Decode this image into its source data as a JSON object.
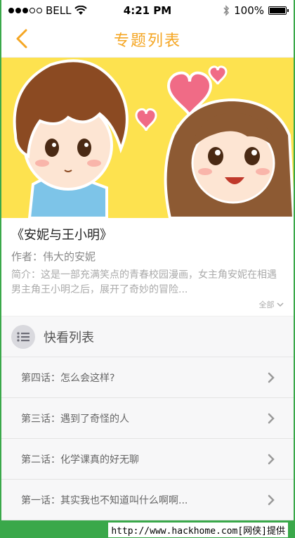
{
  "status_bar": {
    "carrier": "BELL",
    "time": "4:21 PM",
    "battery": "100%",
    "battery_level": 1.0,
    "icons": [
      "signal-dots-icon",
      "wifi-icon",
      "bluetooth-icon",
      "battery-icon"
    ]
  },
  "nav": {
    "back_icon": "chevron-left-icon",
    "title": "专题列表"
  },
  "colors": {
    "accent": "#f5a623",
    "banner_bg": "#fde24f",
    "footer_green": "#3aa84a"
  },
  "comic": {
    "title": "《安妮与王小明》",
    "author": "作者：伟大的安妮",
    "intro": "简介：这是一部充满笑点的青春校园漫画，女主角安妮在相遇男主角王小明之后，展开了奇妙的冒险...",
    "more_label": "全部"
  },
  "episode_list": {
    "header": "快看列表",
    "icon": "list-icon",
    "items": [
      {
        "label": "第四话：怎么会这样?"
      },
      {
        "label": "第三话：遇到了奇怪的人"
      },
      {
        "label": "第二话：化学课真的好无聊"
      },
      {
        "label": "第一话：其实我也不知道叫什么啊啊..."
      }
    ]
  },
  "watermark": "http://www.hackhome.com[网侠]提供"
}
